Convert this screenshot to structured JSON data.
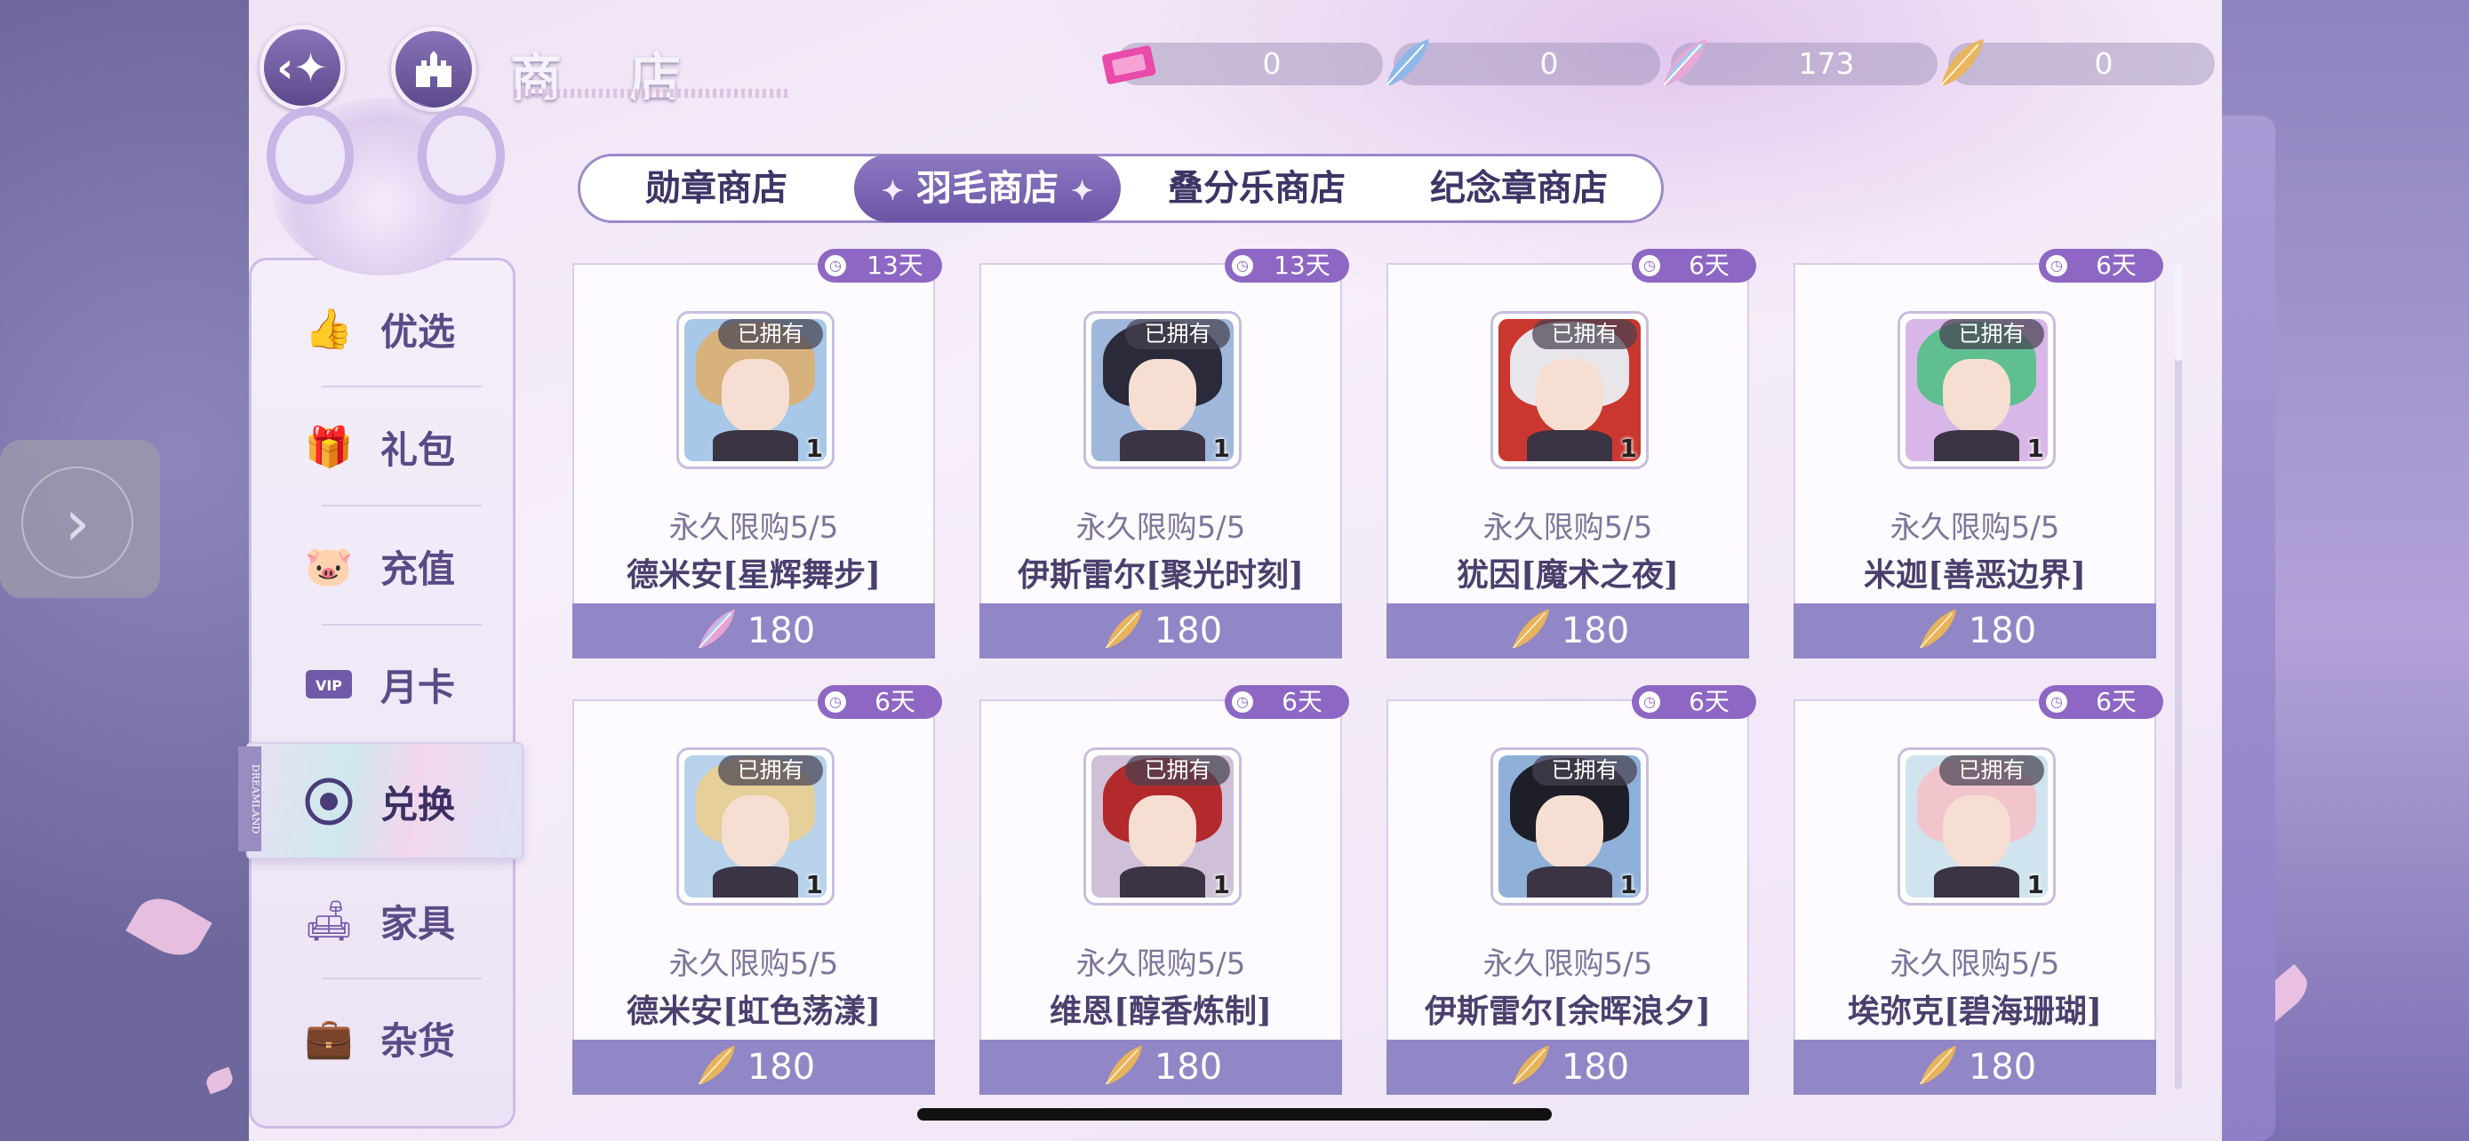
{
  "header": {
    "title": "商 店",
    "back_icon": "back-arrow-sparkle-icon",
    "home_icon": "castle-icon"
  },
  "currencies": [
    {
      "icon": "ticket-icon",
      "amount": "0"
    },
    {
      "icon": "blue-feather-icon",
      "amount": "0"
    },
    {
      "icon": "rainbow-feather-icon",
      "amount": "173"
    },
    {
      "icon": "gold-feather-icon",
      "amount": "0"
    }
  ],
  "tabs": [
    {
      "label": "勋章商店",
      "active": false
    },
    {
      "label": "羽毛商店",
      "active": true
    },
    {
      "label": "叠分乐商店",
      "active": false
    },
    {
      "label": "纪念章商店",
      "active": false
    }
  ],
  "sidebar": {
    "items": [
      {
        "label": "优选",
        "icon": "thumbs-up-icon"
      },
      {
        "label": "礼包",
        "icon": "gift-icon"
      },
      {
        "label": "充值",
        "icon": "piggy-bank-icon"
      },
      {
        "label": "月卡",
        "icon": "vip-card-icon"
      },
      {
        "label": "兑换",
        "icon": "exchange-coin-icon",
        "active": true
      },
      {
        "label": "家具",
        "icon": "sofa-icon"
      },
      {
        "label": "杂货",
        "icon": "bag-icon"
      }
    ],
    "badge_text": "DREAMLAND"
  },
  "products": [
    {
      "days": "13天",
      "owned": "已拥有",
      "qty": "1",
      "limit": "永久限购5/5",
      "name": "德米安[星辉舞步]",
      "price": "180",
      "feather": "rainbow",
      "hair": "#d8b27c",
      "bg": "#a7c8e8"
    },
    {
      "days": "13天",
      "owned": "已拥有",
      "qty": "1",
      "limit": "永久限购5/5",
      "name": "伊斯雷尔[聚光时刻]",
      "price": "180",
      "feather": "gold",
      "hair": "#2a2a3a",
      "bg": "#9fb7da"
    },
    {
      "days": "6天",
      "owned": "已拥有",
      "qty": "1",
      "limit": "永久限购5/5",
      "name": "犹因[魔术之夜]",
      "price": "180",
      "feather": "gold",
      "hair": "#e8e6ea",
      "bg": "#c9372f"
    },
    {
      "days": "6天",
      "owned": "已拥有",
      "qty": "1",
      "limit": "永久限购5/5",
      "name": "米迦[善恶边界]",
      "price": "180",
      "feather": "gold",
      "hair": "#5fbf8f",
      "bg": "#d8b6e8"
    },
    {
      "days": "6天",
      "owned": "已拥有",
      "qty": "1",
      "limit": "永久限购5/5",
      "name": "德米安[虹色荡漾]",
      "price": "180",
      "feather": "gold",
      "hair": "#e6cf98",
      "bg": "#b8d2ec"
    },
    {
      "days": "6天",
      "owned": "已拥有",
      "qty": "1",
      "limit": "永久限购5/5",
      "name": "维恩[醇香炼制]",
      "price": "180",
      "feather": "gold",
      "hair": "#b22a2c",
      "bg": "#cfc0d8"
    },
    {
      "days": "6天",
      "owned": "已拥有",
      "qty": "1",
      "limit": "永久限购5/5",
      "name": "伊斯雷尔[余晖浪夕]",
      "price": "180",
      "feather": "gold",
      "hair": "#1e1e28",
      "bg": "#8fb0d8"
    },
    {
      "days": "6天",
      "owned": "已拥有",
      "qty": "1",
      "limit": "永久限购5/5",
      "name": "埃弥克[碧海珊瑚]",
      "price": "180",
      "feather": "gold",
      "hair": "#f2c4cc",
      "bg": "#cfe4ee"
    }
  ],
  "side_nav": {
    "icon": "chevron-right-icon"
  }
}
